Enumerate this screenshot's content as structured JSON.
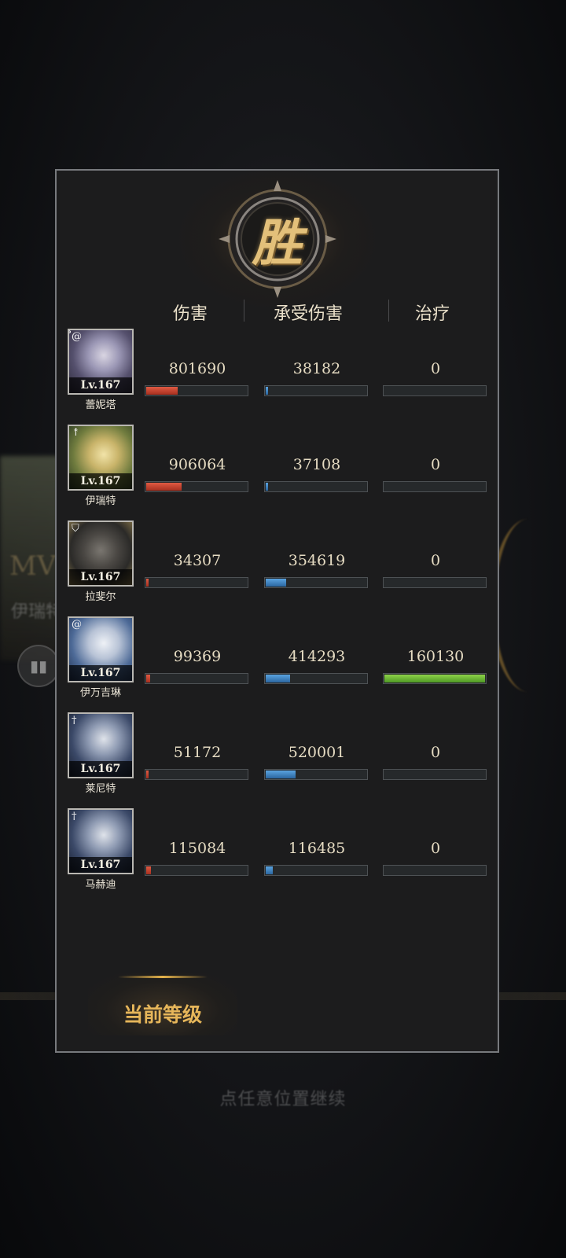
{
  "background": {
    "mvp_text": "MV",
    "mvp_name": "伊瑞特",
    "continue_hint": "点任意位置继续"
  },
  "result": {
    "emblem_text": "胜"
  },
  "columns": {
    "damage": "伤害",
    "taken": "承受伤害",
    "healing": "治疗"
  },
  "heroes": [
    {
      "name": "蕾妮塔",
      "level": "Lv.167",
      "class_icon": "spiral-class-icon",
      "damage": "801690",
      "taken": "38182",
      "healing": "0",
      "damage_pct": 0.31,
      "taken_pct": 0.02,
      "healing_pct": 0
    },
    {
      "name": "伊瑞特",
      "level": "Lv.167",
      "class_icon": "arrow-class-icon",
      "damage": "906064",
      "taken": "37108",
      "healing": "0",
      "damage_pct": 0.35,
      "taken_pct": 0.02,
      "healing_pct": 0
    },
    {
      "name": "拉斐尔",
      "level": "Lv.167",
      "class_icon": "shield-class-icon",
      "damage": "34307",
      "taken": "354619",
      "healing": "0",
      "damage_pct": 0.013,
      "taken_pct": 0.2,
      "healing_pct": 0
    },
    {
      "name": "伊万吉琳",
      "level": "Lv.167",
      "class_icon": "spiral-class-icon",
      "damage": "99369",
      "taken": "414293",
      "healing": "160130",
      "damage_pct": 0.038,
      "taken_pct": 0.24,
      "healing_pct": 1.0
    },
    {
      "name": "莱尼特",
      "level": "Lv.167",
      "class_icon": "cross-class-icon",
      "damage": "51172",
      "taken": "520001",
      "healing": "0",
      "damage_pct": 0.02,
      "taken_pct": 0.3,
      "healing_pct": 0
    },
    {
      "name": "马赫迪",
      "level": "Lv.167",
      "class_icon": "cross-class-icon",
      "damage": "115084",
      "taken": "116485",
      "healing": "0",
      "damage_pct": 0.044,
      "taken_pct": 0.067,
      "healing_pct": 0
    }
  ],
  "tab": {
    "current_level": "当前等级"
  },
  "colors": {
    "damage_bar": "#c8412d",
    "taken_bar": "#3f82c4",
    "healing_bar": "#6fba36",
    "accent_gold": "#e6b65a"
  }
}
